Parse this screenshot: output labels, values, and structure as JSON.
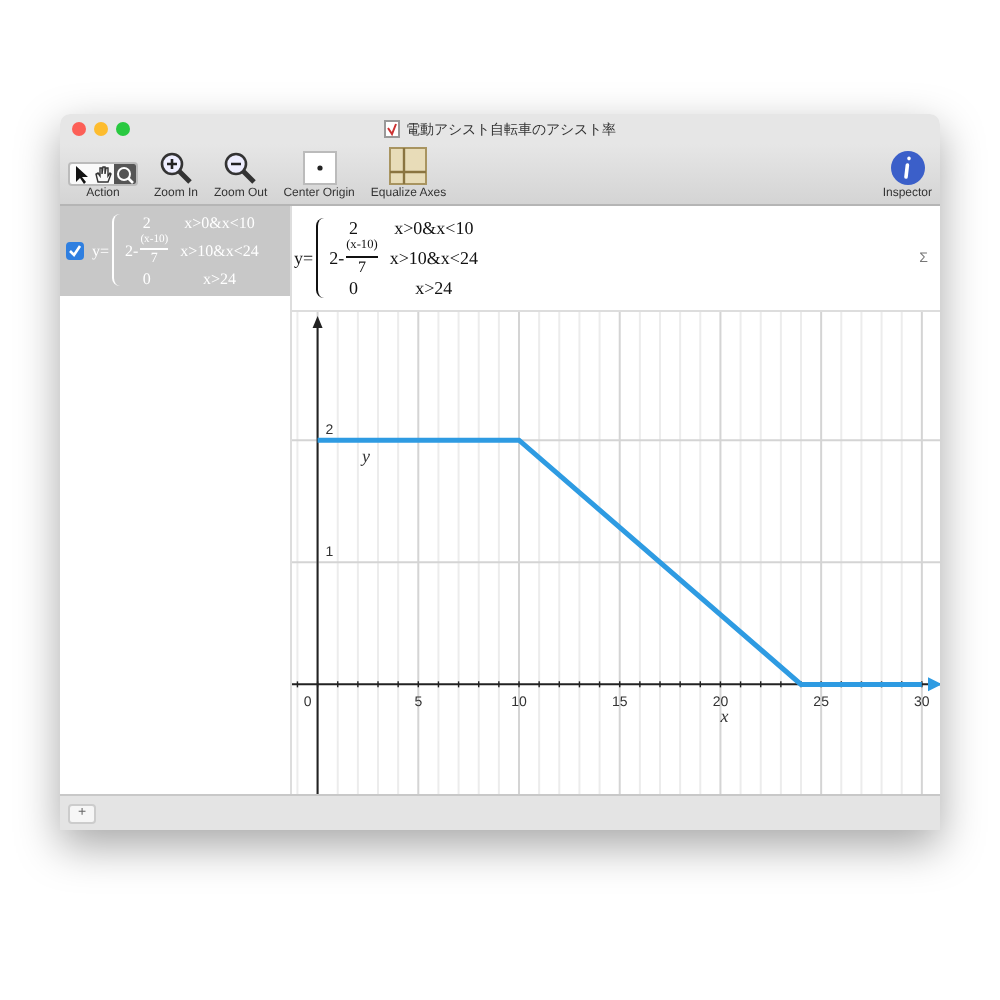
{
  "window": {
    "title": "電動アシスト自転車のアシスト率"
  },
  "toolbar": {
    "tools": [
      {
        "kind": "arrow",
        "selected": false
      },
      {
        "kind": "hand",
        "selected": false
      },
      {
        "kind": "zoom",
        "selected": true
      }
    ],
    "tools_label": "Action",
    "buttons": [
      {
        "kind": "zoom-in",
        "label": "Zoom In"
      },
      {
        "kind": "zoom-out",
        "label": "Zoom Out"
      },
      {
        "kind": "center",
        "label": "Center Origin"
      },
      {
        "kind": "equalize",
        "label": "Equalize Axes"
      }
    ],
    "inspector": "Inspector"
  },
  "sidebar": {
    "items": [
      {
        "checked": true,
        "selected": true,
        "lhs": "y=",
        "cases": [
          {
            "kind": "plain",
            "expr": "2",
            "cond": "x>0&x<10"
          },
          {
            "kind": "fraction",
            "expr": "2-",
            "num": "(x-10)",
            "den": "7",
            "cond": "x>10&x<24"
          },
          {
            "kind": "plain",
            "expr": "0",
            "cond": "x>24"
          }
        ]
      }
    ]
  },
  "editor": {
    "lhs": "y=",
    "cases": [
      {
        "kind": "plain",
        "expr": "2",
        "cond": "x>0&x<10"
      },
      {
        "kind": "fraction",
        "expr": "2-",
        "num": "(x-10)",
        "den": "7",
        "cond": "x>10&x<24"
      },
      {
        "kind": "plain",
        "expr": "0",
        "cond": "x>24"
      }
    ],
    "tool": "Σ"
  },
  "graph": {
    "chart_data": {
      "type": "line",
      "xlabel": "x",
      "grid": true,
      "x": [
        0,
        10,
        24,
        30
      ],
      "series": [
        {
          "name": "y",
          "color": "#2e9be2",
          "values": [
            2,
            2,
            0,
            0
          ]
        }
      ],
      "xlim": [
        -1.27,
        31
      ],
      "ylim": [
        -0.98,
        3.05
      ],
      "xticks": [
        0,
        5,
        10,
        15,
        20,
        25,
        30
      ],
      "yticks": [
        1,
        2
      ]
    }
  },
  "status_bar": {
    "add_button": "+"
  }
}
